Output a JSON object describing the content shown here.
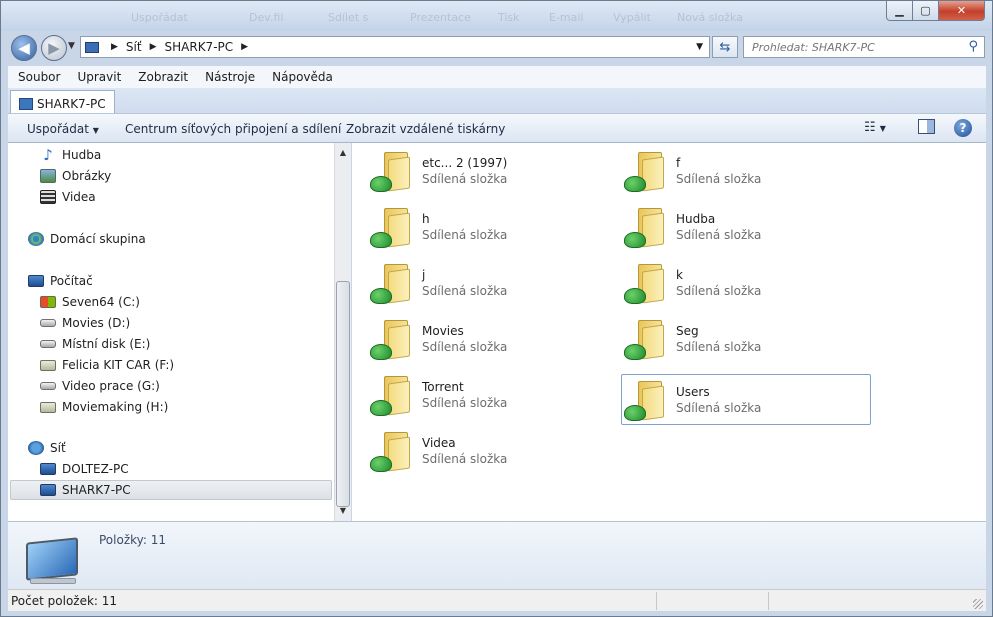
{
  "window": {
    "controls": {
      "minimize": "▁",
      "maximize": "▢",
      "close": "✕"
    }
  },
  "ghost_toolbar": [
    "Uspořádat",
    "Dev.fil",
    "Sdílet s",
    "Prezentace",
    "Tisk",
    "E-mail",
    "Vypálit",
    "Nová složka"
  ],
  "address": {
    "segments": [
      "Síť",
      "SHARK7-PC"
    ]
  },
  "search": {
    "placeholder": "Prohledat: SHARK7-PC"
  },
  "menu": [
    "Soubor",
    "Upravit",
    "Zobrazit",
    "Nástroje",
    "Nápověda"
  ],
  "tab": {
    "label": "SHARK7-PC"
  },
  "toolbar": {
    "organize": "Uspořádat",
    "network_center": "Centrum síťových připojení a sdílení",
    "remote_printers": "Zobrazit vzdálené tiskárny"
  },
  "nav": {
    "libraries": [
      {
        "label": "Hudba",
        "icon": "music-icon"
      },
      {
        "label": "Obrázky",
        "icon": "pictures-icon"
      },
      {
        "label": "Videa",
        "icon": "video-icon"
      }
    ],
    "homegroup": "Domácí skupina",
    "computer": "Počítač",
    "drives": [
      {
        "label": "Seven64 (C:)",
        "icon": "system-drive-icon"
      },
      {
        "label": "Movies (D:)",
        "icon": "drive-icon"
      },
      {
        "label": "Místní disk (E:)",
        "icon": "drive-icon"
      },
      {
        "label": "Felicia KIT CAR (F:)",
        "icon": "removable-drive-icon"
      },
      {
        "label": "Video prace (G:)",
        "icon": "drive-icon"
      },
      {
        "label": "Moviemaking (H:)",
        "icon": "removable-drive-icon"
      }
    ],
    "network": "Síť",
    "computers": [
      "DOLTEZ-PC",
      "SHARK7-PC"
    ]
  },
  "folders": [
    {
      "name": "etc... 2 (1997)",
      "desc": "Sdílená složka"
    },
    {
      "name": "f",
      "desc": "Sdílená složka"
    },
    {
      "name": "h",
      "desc": "Sdílená složka"
    },
    {
      "name": "Hudba",
      "desc": "Sdílená složka"
    },
    {
      "name": "j",
      "desc": "Sdílená složka"
    },
    {
      "name": "k",
      "desc": "Sdílená složka"
    },
    {
      "name": "Movies",
      "desc": "Sdílená složka"
    },
    {
      "name": "Seg",
      "desc": "Sdílená složka"
    },
    {
      "name": "Torrent",
      "desc": "Sdílená složka"
    },
    {
      "name": "Users",
      "desc": "Sdílená složka"
    },
    {
      "name": "Videa",
      "desc": "Sdílená složka"
    }
  ],
  "details": {
    "count": "Položky: 11"
  },
  "status": {
    "text": "Počet položek: 11"
  }
}
